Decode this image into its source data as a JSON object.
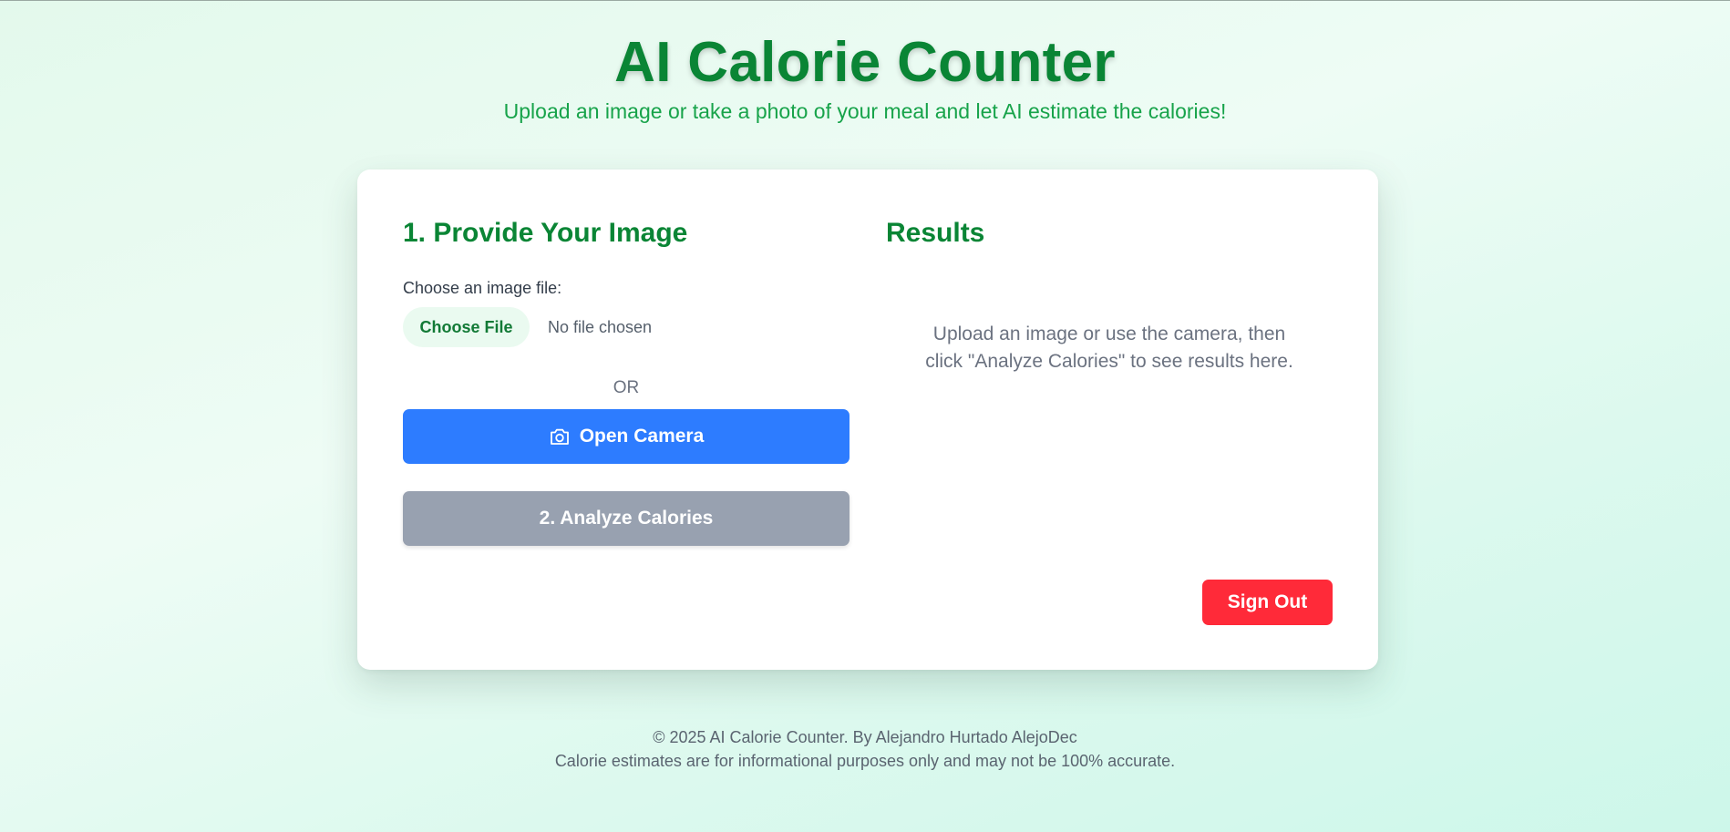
{
  "header": {
    "title": "AI Calorie Counter",
    "subtitle": "Upload an image or take a photo of your meal and let AI estimate the calories!"
  },
  "input_section": {
    "title": "1. Provide Your Image",
    "file_label": "Choose an image file:",
    "choose_file_label": "Choose File",
    "file_status": "No file chosen",
    "or_text": "OR",
    "camera_button_label": "Open Camera",
    "camera_icon": "camera-icon",
    "analyze_button_label": "2. Analyze Calories"
  },
  "results_section": {
    "title": "Results",
    "placeholder": "Upload an image or use the camera, then click \"Analyze Calories\" to see results here."
  },
  "sign_out_label": "Sign Out",
  "footer": {
    "copyright": "© 2025 AI Calorie Counter. By Alejandro Hurtado AlejoDec",
    "disclaimer": "Calorie estimates are for informational purposes only and may not be 100% accurate."
  },
  "colors": {
    "brand_green": "#0a8535",
    "subtitle_green": "#17a34a",
    "camera_blue": "#2d7cff",
    "analyze_disabled_gray": "#98a1b0",
    "sign_out_red": "#ff2a39"
  }
}
